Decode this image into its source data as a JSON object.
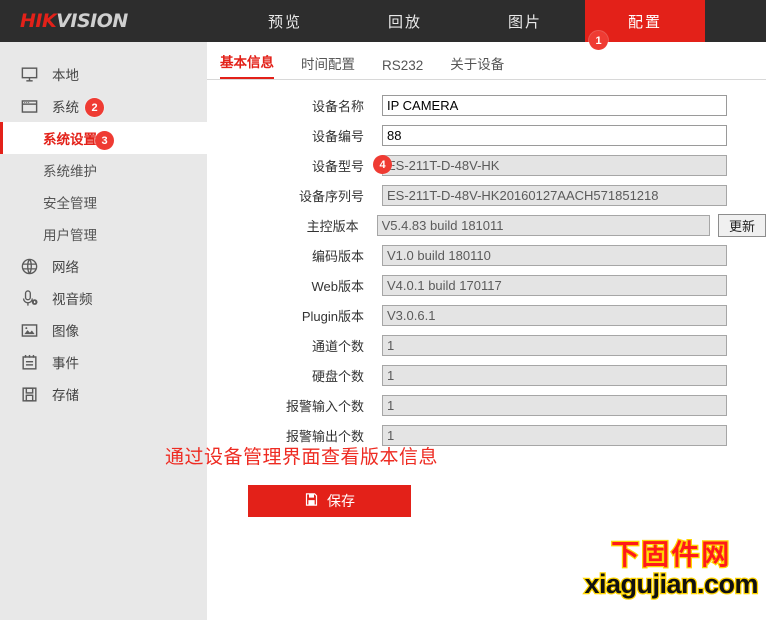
{
  "brand": {
    "red_part": "HIK",
    "gray_part": "VISION"
  },
  "topnav": {
    "items": [
      {
        "label": "预览",
        "active": false
      },
      {
        "label": "回放",
        "active": false
      },
      {
        "label": "图片",
        "active": false
      },
      {
        "label": "配置",
        "active": true
      }
    ]
  },
  "badges": {
    "b1": "1",
    "b2": "2",
    "b3": "3",
    "b4": "4"
  },
  "sidebar": {
    "items": [
      {
        "label": "本地",
        "icon": "monitor-icon"
      },
      {
        "label": "系统",
        "icon": "window-icon"
      },
      {
        "label": "网络",
        "icon": "globe-icon"
      },
      {
        "label": "视音频",
        "icon": "audio-video-icon"
      },
      {
        "label": "图像",
        "icon": "image-icon"
      },
      {
        "label": "事件",
        "icon": "event-icon"
      },
      {
        "label": "存储",
        "icon": "storage-icon"
      }
    ],
    "sub_items": [
      {
        "label": "系统设置",
        "active": true
      },
      {
        "label": "系统维护",
        "active": false
      },
      {
        "label": "安全管理",
        "active": false
      },
      {
        "label": "用户管理",
        "active": false
      }
    ]
  },
  "tabs": [
    {
      "label": "基本信息",
      "active": true
    },
    {
      "label": "时间配置",
      "active": false
    },
    {
      "label": "RS232",
      "active": false
    },
    {
      "label": "关于设备",
      "active": false
    }
  ],
  "form": {
    "rows": [
      {
        "label": "设备名称",
        "value": "IP CAMERA",
        "readonly": false,
        "button": null
      },
      {
        "label": "设备编号",
        "value": "88",
        "readonly": false,
        "button": null
      },
      {
        "label": "设备型号",
        "value": "ES-211T-D-48V-HK",
        "readonly": true,
        "button": null
      },
      {
        "label": "设备序列号",
        "value": "ES-211T-D-48V-HK20160127AACH571851218",
        "readonly": true,
        "button": null
      },
      {
        "label": "主控版本",
        "value": "V5.4.83 build 181011",
        "readonly": true,
        "button": "更新"
      },
      {
        "label": "编码版本",
        "value": "V1.0 build 180110",
        "readonly": true,
        "button": null
      },
      {
        "label": "Web版本",
        "value": "V4.0.1 build 170117",
        "readonly": true,
        "button": null
      },
      {
        "label": "Plugin版本",
        "value": "V3.0.6.1",
        "readonly": true,
        "button": null
      },
      {
        "label": "通道个数",
        "value": "1",
        "readonly": true,
        "button": null
      },
      {
        "label": "硬盘个数",
        "value": "1",
        "readonly": true,
        "button": null
      },
      {
        "label": "报警输入个数",
        "value": "1",
        "readonly": true,
        "button": null
      },
      {
        "label": "报警输出个数",
        "value": "1",
        "readonly": true,
        "button": null
      }
    ]
  },
  "annotation": "通过设备管理界面查看版本信息",
  "save_button": {
    "label": "保存",
    "icon": "save-disk-icon"
  },
  "watermark": {
    "cn": "下固件网",
    "en": "xiagujian.com"
  },
  "colors": {
    "brand_red": "#e32119",
    "badge_red": "#ef3b33",
    "header_dark": "#2d2d2d",
    "sidebar_gray": "#e8e8e8",
    "annotation_red": "#ee2b22",
    "watermark_red": "#ff1a1a",
    "watermark_outline": "#ffd500"
  }
}
